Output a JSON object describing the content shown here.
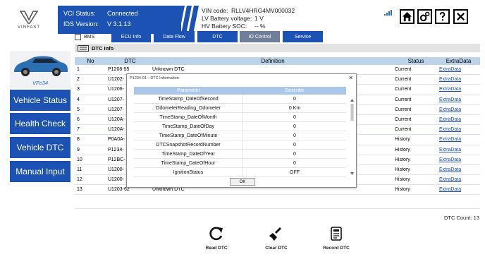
{
  "brand": {
    "logo_text": "VINFAST"
  },
  "vci": {
    "status_label": "VCI Status:",
    "status_value": "Connected",
    "ids_label": "IDS Version:",
    "ids_value": "V  3.1.13"
  },
  "vehicle": {
    "vin_label": "VIN code:",
    "vin_value": "RLLV4HRG4MV000032",
    "lv_label": "LV Battery voltage:",
    "lv_value": "1 V",
    "hv_label": "HV Battery SOC:",
    "hv_value": "-- %"
  },
  "signal_icon": "signal-icon",
  "top_buttons": [
    "home-icon",
    "settings-icon",
    "help-icon",
    "close-icon"
  ],
  "tabs": {
    "bms": "BMS",
    "items": [
      "ECU Info",
      "Data Flow",
      "DTC",
      "IO Control",
      "Service"
    ],
    "active": "IO Control"
  },
  "section_title": "DTC Info",
  "car_model": "VFe34",
  "sidebar": [
    "Vehicle Status",
    "Health Check",
    "Vehicle DTC",
    "Manual Input"
  ],
  "table": {
    "headers": [
      "No",
      "DTC",
      "Definition",
      "Status",
      "ExtraData"
    ],
    "rows": [
      {
        "no": "1",
        "dtc": "P1208-55",
        "def": "Unknown DTC",
        "status": "Current",
        "extra": "ExtraData"
      },
      {
        "no": "2",
        "dtc": "U1202-",
        "def": "",
        "status": "Current",
        "extra": "ExtraData"
      },
      {
        "no": "3",
        "dtc": "U1206-",
        "def": "",
        "status": "Current",
        "extra": "ExtraData"
      },
      {
        "no": "4",
        "dtc": "U1207-",
        "def": "",
        "status": "Current",
        "extra": "ExtraData"
      },
      {
        "no": "5",
        "dtc": "U1207-",
        "def": "",
        "status": "Current",
        "extra": "ExtraData"
      },
      {
        "no": "6",
        "dtc": "U120A-",
        "def": "",
        "status": "Current",
        "extra": "ExtraData"
      },
      {
        "no": "7",
        "dtc": "U120A-",
        "def": "",
        "status": "Current",
        "extra": "ExtraData"
      },
      {
        "no": "8",
        "dtc": "P0A0A-",
        "def": "",
        "status": "History",
        "extra": "ExtraData"
      },
      {
        "no": "9",
        "dtc": "P1234-",
        "def": "",
        "status": "History",
        "extra": "ExtraData"
      },
      {
        "no": "10",
        "dtc": "P12BC-",
        "def": "",
        "status": "History",
        "extra": "ExtraData"
      },
      {
        "no": "11",
        "dtc": "U1200-",
        "def": "",
        "status": "History",
        "extra": "ExtraData"
      },
      {
        "no": "12",
        "dtc": "U1200-",
        "def": "",
        "status": "History",
        "extra": "ExtraData"
      },
      {
        "no": "13",
        "dtc": "U1203-62",
        "def": "Unknown DTC",
        "status": "History",
        "extra": "ExtraData"
      }
    ]
  },
  "dtc_count": {
    "label": "DTC Count:",
    "value": "13"
  },
  "toolbar": [
    "Read DTC",
    "Clear DTC",
    "Record DTC"
  ],
  "modal": {
    "title": "P1234-01---DTC Information",
    "headers": [
      "Parameter",
      "Describe"
    ],
    "rows": [
      {
        "param": "TimeStamp_DateOfSecond",
        "value": "0"
      },
      {
        "param": "OdometerReading_Odometer",
        "value": "0 Km"
      },
      {
        "param": "TimeStamp_DateOfMonth",
        "value": "0"
      },
      {
        "param": "TimeStamp_DateOfDay",
        "value": "0"
      },
      {
        "param": "TimeStamp_DateOfMinute",
        "value": "0"
      },
      {
        "param": "DTCSnapshotRecordNumber",
        "value": "0"
      },
      {
        "param": "TimeStamp_DateOfYear",
        "value": "0"
      },
      {
        "param": "TimeStamp_DateOfHour",
        "value": "0"
      },
      {
        "param": "IgnitionStatus",
        "value": "OFF"
      }
    ],
    "ok_label": "OK"
  },
  "colors": {
    "primary": "#1b52b3",
    "header_row": "#bcd3ea",
    "active_tab": "#6f7f99"
  }
}
